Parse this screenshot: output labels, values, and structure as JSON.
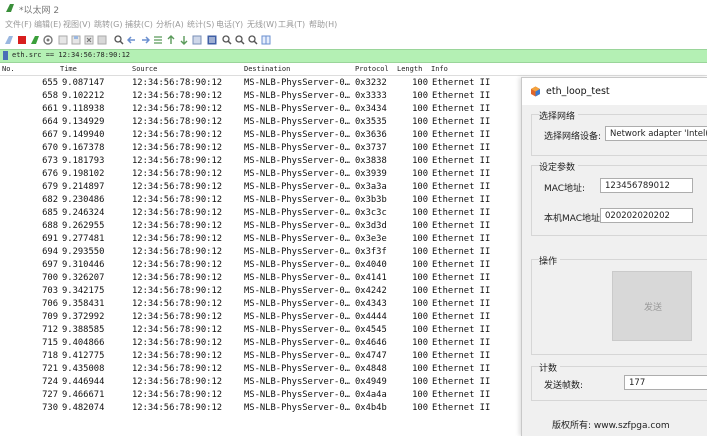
{
  "window": {
    "title": "*以太网 2"
  },
  "menu": [
    "文件(F)",
    "编辑(E)",
    "视图(V)",
    "跳转(G)",
    "捕获(C)",
    "分析(A)",
    "统计(S)",
    "电话(Y)",
    "无线(W)",
    "工具(T)",
    "帮助(H)"
  ],
  "filter": {
    "value": "eth.src == 12:34:56:78:90:12"
  },
  "columns": {
    "no": "No.",
    "time": "Time",
    "source": "Source",
    "destination": "Destination",
    "protocol": "Protocol",
    "length": "Length",
    "info": "Info"
  },
  "packets": [
    {
      "no": "655",
      "time": "9.087147",
      "src": "12:34:56:78:90:12",
      "dst": "MS-NLB-PhysServer-0…",
      "proto": "0x3232",
      "len": "100",
      "info": "Ethernet II"
    },
    {
      "no": "658",
      "time": "9.102212",
      "src": "12:34:56:78:90:12",
      "dst": "MS-NLB-PhysServer-0…",
      "proto": "0x3333",
      "len": "100",
      "info": "Ethernet II"
    },
    {
      "no": "661",
      "time": "9.118938",
      "src": "12:34:56:78:90:12",
      "dst": "MS-NLB-PhysServer-0…",
      "proto": "0x3434",
      "len": "100",
      "info": "Ethernet II"
    },
    {
      "no": "664",
      "time": "9.134929",
      "src": "12:34:56:78:90:12",
      "dst": "MS-NLB-PhysServer-0…",
      "proto": "0x3535",
      "len": "100",
      "info": "Ethernet II"
    },
    {
      "no": "667",
      "time": "9.149940",
      "src": "12:34:56:78:90:12",
      "dst": "MS-NLB-PhysServer-0…",
      "proto": "0x3636",
      "len": "100",
      "info": "Ethernet II"
    },
    {
      "no": "670",
      "time": "9.167378",
      "src": "12:34:56:78:90:12",
      "dst": "MS-NLB-PhysServer-0…",
      "proto": "0x3737",
      "len": "100",
      "info": "Ethernet II"
    },
    {
      "no": "673",
      "time": "9.181793",
      "src": "12:34:56:78:90:12",
      "dst": "MS-NLB-PhysServer-0…",
      "proto": "0x3838",
      "len": "100",
      "info": "Ethernet II"
    },
    {
      "no": "676",
      "time": "9.198102",
      "src": "12:34:56:78:90:12",
      "dst": "MS-NLB-PhysServer-0…",
      "proto": "0x3939",
      "len": "100",
      "info": "Ethernet II"
    },
    {
      "no": "679",
      "time": "9.214897",
      "src": "12:34:56:78:90:12",
      "dst": "MS-NLB-PhysServer-0…",
      "proto": "0x3a3a",
      "len": "100",
      "info": "Ethernet II"
    },
    {
      "no": "682",
      "time": "9.230486",
      "src": "12:34:56:78:90:12",
      "dst": "MS-NLB-PhysServer-0…",
      "proto": "0x3b3b",
      "len": "100",
      "info": "Ethernet II"
    },
    {
      "no": "685",
      "time": "9.246324",
      "src": "12:34:56:78:90:12",
      "dst": "MS-NLB-PhysServer-0…",
      "proto": "0x3c3c",
      "len": "100",
      "info": "Ethernet II"
    },
    {
      "no": "688",
      "time": "9.262955",
      "src": "12:34:56:78:90:12",
      "dst": "MS-NLB-PhysServer-0…",
      "proto": "0x3d3d",
      "len": "100",
      "info": "Ethernet II"
    },
    {
      "no": "691",
      "time": "9.277481",
      "src": "12:34:56:78:90:12",
      "dst": "MS-NLB-PhysServer-0…",
      "proto": "0x3e3e",
      "len": "100",
      "info": "Ethernet II"
    },
    {
      "no": "694",
      "time": "9.293550",
      "src": "12:34:56:78:90:12",
      "dst": "MS-NLB-PhysServer-0…",
      "proto": "0x3f3f",
      "len": "100",
      "info": "Ethernet II"
    },
    {
      "no": "697",
      "time": "9.310446",
      "src": "12:34:56:78:90:12",
      "dst": "MS-NLB-PhysServer-0…",
      "proto": "0x4040",
      "len": "100",
      "info": "Ethernet II"
    },
    {
      "no": "700",
      "time": "9.326207",
      "src": "12:34:56:78:90:12",
      "dst": "MS-NLB-PhysServer-0…",
      "proto": "0x4141",
      "len": "100",
      "info": "Ethernet II"
    },
    {
      "no": "703",
      "time": "9.342175",
      "src": "12:34:56:78:90:12",
      "dst": "MS-NLB-PhysServer-0…",
      "proto": "0x4242",
      "len": "100",
      "info": "Ethernet II"
    },
    {
      "no": "706",
      "time": "9.358431",
      "src": "12:34:56:78:90:12",
      "dst": "MS-NLB-PhysServer-0…",
      "proto": "0x4343",
      "len": "100",
      "info": "Ethernet II"
    },
    {
      "no": "709",
      "time": "9.372992",
      "src": "12:34:56:78:90:12",
      "dst": "MS-NLB-PhysServer-0…",
      "proto": "0x4444",
      "len": "100",
      "info": "Ethernet II"
    },
    {
      "no": "712",
      "time": "9.388585",
      "src": "12:34:56:78:90:12",
      "dst": "MS-NLB-PhysServer-0…",
      "proto": "0x4545",
      "len": "100",
      "info": "Ethernet II"
    },
    {
      "no": "715",
      "time": "9.404866",
      "src": "12:34:56:78:90:12",
      "dst": "MS-NLB-PhysServer-0…",
      "proto": "0x4646",
      "len": "100",
      "info": "Ethernet II"
    },
    {
      "no": "718",
      "time": "9.412775",
      "src": "12:34:56:78:90:12",
      "dst": "MS-NLB-PhysServer-0…",
      "proto": "0x4747",
      "len": "100",
      "info": "Ethernet II"
    },
    {
      "no": "721",
      "time": "9.435008",
      "src": "12:34:56:78:90:12",
      "dst": "MS-NLB-PhysServer-0…",
      "proto": "0x4848",
      "len": "100",
      "info": "Ethernet II"
    },
    {
      "no": "724",
      "time": "9.446944",
      "src": "12:34:56:78:90:12",
      "dst": "MS-NLB-PhysServer-0…",
      "proto": "0x4949",
      "len": "100",
      "info": "Ethernet II"
    },
    {
      "no": "727",
      "time": "9.466671",
      "src": "12:34:56:78:90:12",
      "dst": "MS-NLB-PhysServer-0…",
      "proto": "0x4a4a",
      "len": "100",
      "info": "Ethernet II"
    },
    {
      "no": "730",
      "time": "9.482074",
      "src": "12:34:56:78:90:12",
      "dst": "MS-NLB-PhysServer-0…",
      "proto": "0x4b4b",
      "len": "100",
      "info": "Ethernet II"
    }
  ],
  "dialog": {
    "title": "eth_loop_test",
    "select_group": "选择网络",
    "device_label": "选择网络设备:",
    "device_value": "Network adapter 'Intel(R)",
    "params_group": "设定参数",
    "mac_label": "MAC地址:",
    "mac_value": "123456789012",
    "local_mac_label": "本机MAC地址:",
    "local_mac_value": "020202020202",
    "ops_group": "操作",
    "send_label": "发送",
    "count_group": "计数",
    "sent_label": "发送帧数:",
    "sent_value": "177",
    "copyright": "版权所有: www.szfpga.com"
  },
  "colors": {
    "filter_bg": "#b4f0b4",
    "dialog_bg": "#f0f0f0"
  }
}
